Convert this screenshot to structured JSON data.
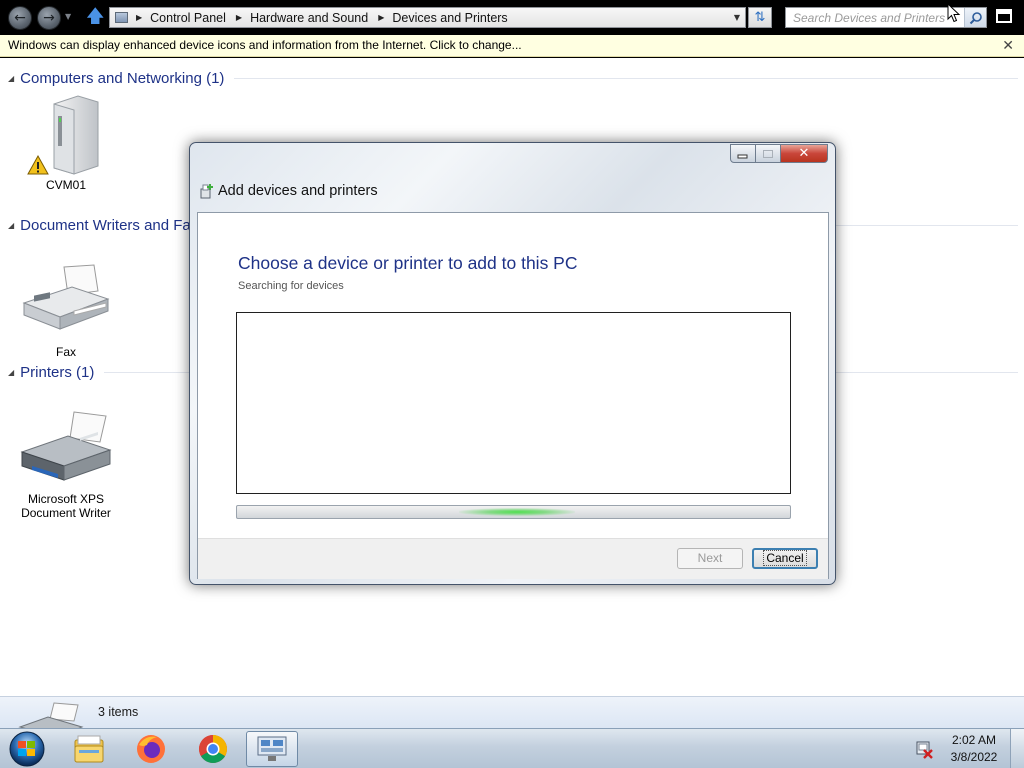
{
  "window": {
    "breadcrumbs": [
      "Control Panel",
      "Hardware and Sound",
      "Devices and Printers"
    ],
    "search_placeholder": "Search Devices and Printers"
  },
  "info_bar": {
    "message": "Windows can display enhanced device icons and information from the Internet. Click to change..."
  },
  "groups": [
    {
      "title": "Computers and Networking (1)",
      "devices": [
        {
          "label": "CVM01",
          "icon": "computer-tower-icon",
          "warning": true
        }
      ]
    },
    {
      "title": "Document Writers and Fa",
      "devices": [
        {
          "label": "Fax",
          "icon": "fax-icon"
        }
      ]
    },
    {
      "title": "Printers (1)",
      "devices": [
        {
          "label_line1": "Microsoft XPS",
          "label_line2": "Document Writer",
          "icon": "printer-icon"
        }
      ]
    }
  ],
  "status_bar": {
    "text": "3 items"
  },
  "dialog": {
    "title": "Add devices and printers",
    "heading": "Choose a device or printer to add to this PC",
    "status": "Searching for devices",
    "progress_indeterminate": true,
    "buttons": {
      "next": "Next",
      "cancel": "Cancel"
    },
    "next_enabled": false
  },
  "taskbar": {
    "pinned": [
      "explorer-icon",
      "firefox-icon",
      "chrome-icon",
      "devices-and-printers-icon"
    ],
    "active": "devices-and-printers-icon",
    "clock_time": "2:02 AM",
    "clock_date": "3/8/2022"
  },
  "colors": {
    "group_title": "#1e3287",
    "info_bar_bg": "#ffffe1",
    "dialog_heading": "#1e3287",
    "progress_glow": "#4ee04e"
  }
}
